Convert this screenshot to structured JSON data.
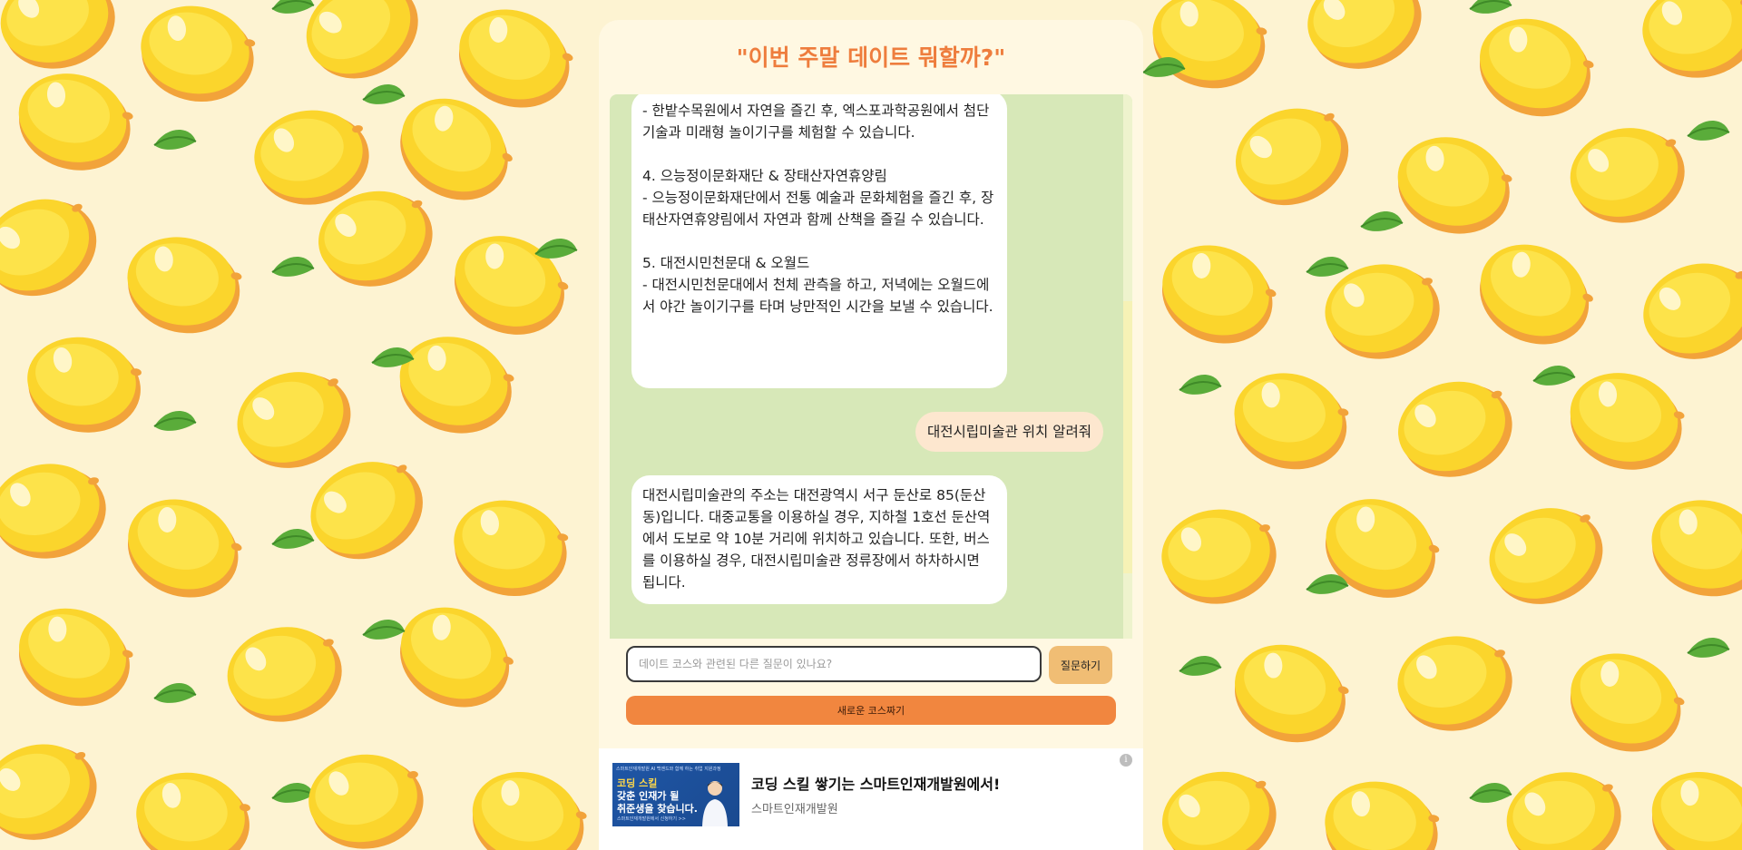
{
  "page": {
    "title": "\"이번 주말 데이트 뭐할까?\"",
    "colors": {
      "accent": "#ee7d3d",
      "chat_bg": "#d7e8b8",
      "page_bg": "#fdf3d2",
      "user_bubble": "#fde7cf",
      "ask_button": "#f0bd74",
      "new_button": "#f1863f"
    }
  },
  "chat": {
    "messages": [
      {
        "role": "bot",
        "paragraphs": [
          "- 한밭수목원에서 자연을 즐긴 후, 엑스포과학공원에서 첨단 기술과 미래형 놀이기구를 체험할 수 있습니다.",
          "",
          "4. 으능정이문화재단 & 장태산자연휴양림",
          "- 으능정이문화재단에서 전통 예술과 문화체험을 즐긴 후, 장태산자연휴양림에서 자연과 함께 산책을 즐길 수 있습니다.",
          "",
          "5. 대전시민천문대 & 오월드",
          "- 대전시민천문대에서 천체 관측을 하고, 저녁에는 오월드에서 야간 놀이기구를 타며 낭만적인 시간을 보낼 수 있습니다."
        ]
      },
      {
        "role": "user",
        "text": "대전시립미술관 위치 알려줘"
      },
      {
        "role": "bot",
        "paragraphs": [
          "대전시립미술관의 주소는 대전광역시 서구 둔산로 85(둔산동)입니다. 대중교통을 이용하실 경우, 지하철 1호선 둔산역에서 도보로 약 10분 거리에 위치하고 있습니다. 또한, 버스를 이용하실 경우, 대전시립미술관 정류장에서 하차하시면 됩니다."
        ]
      }
    ]
  },
  "input": {
    "placeholder": "데이트 코스와 관련된 다른 질문이 있나요?",
    "value": ""
  },
  "buttons": {
    "ask": "질문하기",
    "new_course": "새로운 코스짜기"
  },
  "ad": {
    "headline": "코딩 스킬 쌓기는 스마트인재개발원에서!",
    "advertiser": "스마트인재개발원",
    "image_text": {
      "top": "스마트인재개발원 AI 백엔드와 함께 하는 취업 지원과정",
      "line1": "코딩 스킬",
      "line2": "갖춘 인재가 될",
      "line3": "취준생을 찾습니다.",
      "cta": "스마트인재개발원에서 신청하기 >>"
    },
    "info_icon": "info-icon"
  }
}
